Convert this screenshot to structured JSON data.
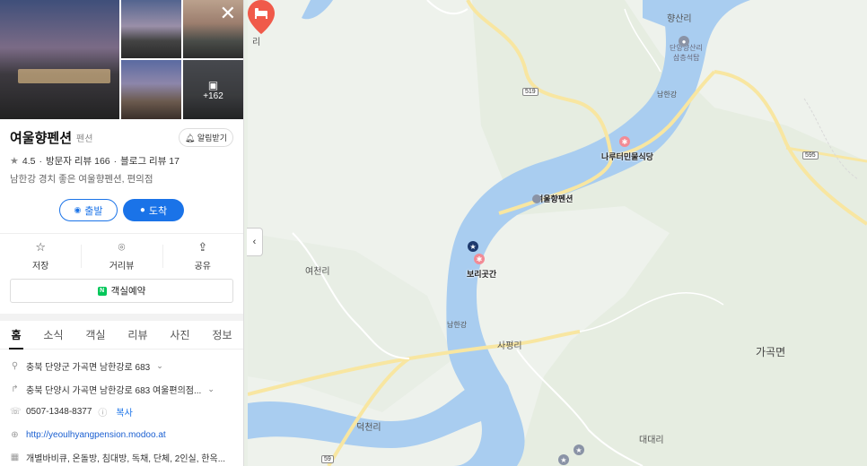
{
  "place": {
    "name": "여울향펜션",
    "category": "펜션",
    "rating": "4.5",
    "visitor_reviews": "방문자 리뷰 166",
    "blog_reviews": "블로그 리뷰 17",
    "description": "남한강 경치 좋은 여울향펜션, 편의점",
    "photo_count": "+162"
  },
  "buttons": {
    "alarm": "알림받기",
    "start": "출발",
    "arrive": "도착",
    "reserve": "객실예약"
  },
  "actions": [
    {
      "label": "저장",
      "icon": "star-outline-icon"
    },
    {
      "label": "거리뷰",
      "icon": "map-pin-icon"
    },
    {
      "label": "공유",
      "icon": "share-icon"
    }
  ],
  "tabs": [
    "홈",
    "소식",
    "객실",
    "리뷰",
    "사진",
    "정보"
  ],
  "active_tab": "홈",
  "details": {
    "address_old": "충북 단양군 가곡면 남한강로 683",
    "address_road": "충북 단양시 가곡면 남한강로 683 여울편의점...",
    "phone": "0507-1348-8377",
    "copy_label": "복사",
    "website": "http://yeoulhyangpension.modoo.at",
    "facilities": "개별바비큐, 온돌방, 침대방, 독채, 단체, 2인실, 한옥..."
  },
  "map": {
    "labels": {
      "hyangsanri": "향산리",
      "hyangsanri_tower": "단양향산리",
      "tower_sub": "삼층석탑",
      "namhan_river_top": "남한강",
      "restaurant": "나루터민물식당",
      "pension": "여울향펜션",
      "borigotgan": "보리곳간",
      "yeocheonri": "여천리",
      "namhan_river_mid": "남한강",
      "sapyeongri": "사평리",
      "gagokmyeon": "가곡면",
      "deokcheonri": "덕천리",
      "daedaeri": "대대리",
      "left_ri": "리"
    },
    "roads": {
      "r519": "519",
      "r595": "595",
      "r59": "59"
    },
    "colors": {
      "water": "#a9cdf0",
      "road": "#fbe9a8",
      "pin": "#f05a4a",
      "accent": "#1a73e8"
    }
  }
}
